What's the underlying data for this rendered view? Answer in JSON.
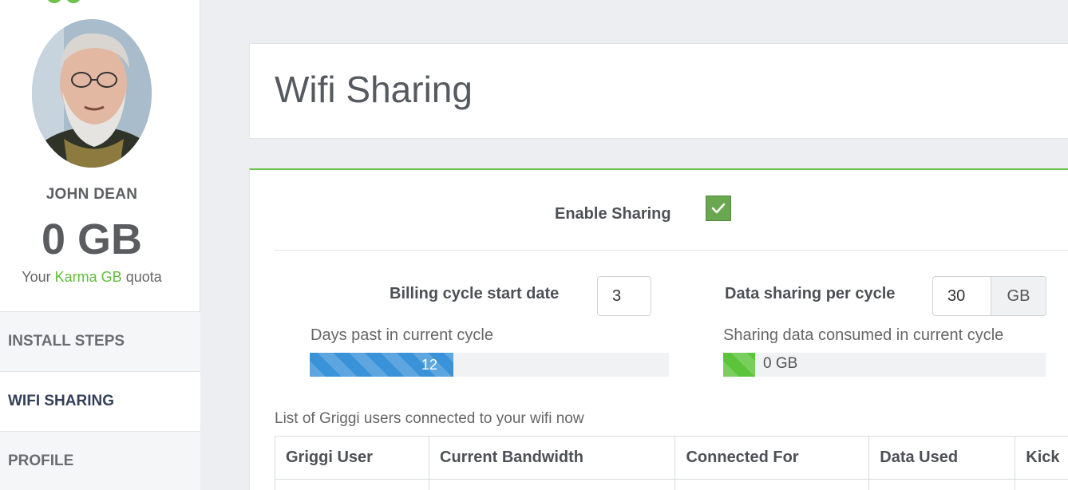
{
  "user": {
    "name": "JOHN DEAN",
    "quota_amount": "0 GB",
    "quota_caption_prefix": "Your",
    "quota_caption_brand": "Karma GB",
    "quota_caption_suffix": "quota"
  },
  "nav": {
    "items": [
      {
        "label": "INSTALL STEPS",
        "active": false
      },
      {
        "label": "WIFI SHARING",
        "active": true
      },
      {
        "label": "PROFILE",
        "active": false
      }
    ]
  },
  "page": {
    "title": "Wifi Sharing"
  },
  "sharing": {
    "enable_label": "Enable Sharing",
    "enabled": true,
    "billing_label": "Billing cycle start date",
    "billing_value": "3",
    "data_label": "Data sharing per cycle",
    "data_value": "30",
    "data_unit": "GB",
    "days_label": "Days past in current cycle",
    "days_value": "12",
    "days_progress_fraction": 0.4,
    "consumed_label": "Sharing data consumed in current cycle",
    "consumed_value": "0 GB"
  },
  "users_table": {
    "caption": "List of Griggi users connected to your wifi now",
    "columns": [
      "Griggi User",
      "Current Bandwidth",
      "Connected For",
      "Data Used",
      "Kick"
    ]
  },
  "colors": {
    "accent_green": "#6cc24a",
    "progress_blue": "#3a93d8",
    "heading_dark": "#34405a"
  }
}
